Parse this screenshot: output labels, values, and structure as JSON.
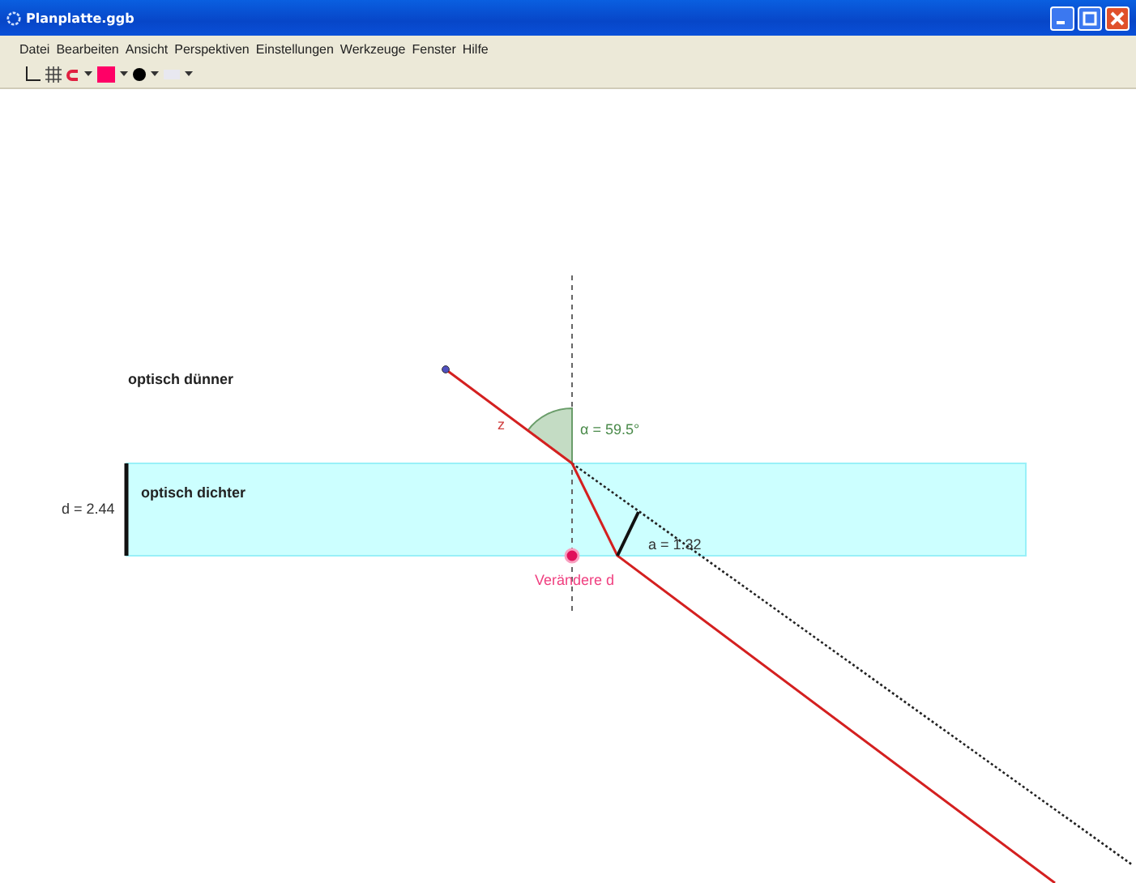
{
  "window": {
    "title": "Planplatte.ggb"
  },
  "menu": [
    "Datei",
    "Bearbeiten",
    "Ansicht",
    "Perspektiven",
    "Einstellungen",
    "Werkzeuge",
    "Fenster",
    "Hilfe"
  ],
  "canvas": {
    "upper_label": "optisch dünner",
    "lower_label": "optisch dichter",
    "thickness_label": "d = 2.44",
    "ray_label": "z",
    "angle_label": "α = 59.5°",
    "offset_label": "a = 1.32",
    "point_label": "Verändere d"
  }
}
